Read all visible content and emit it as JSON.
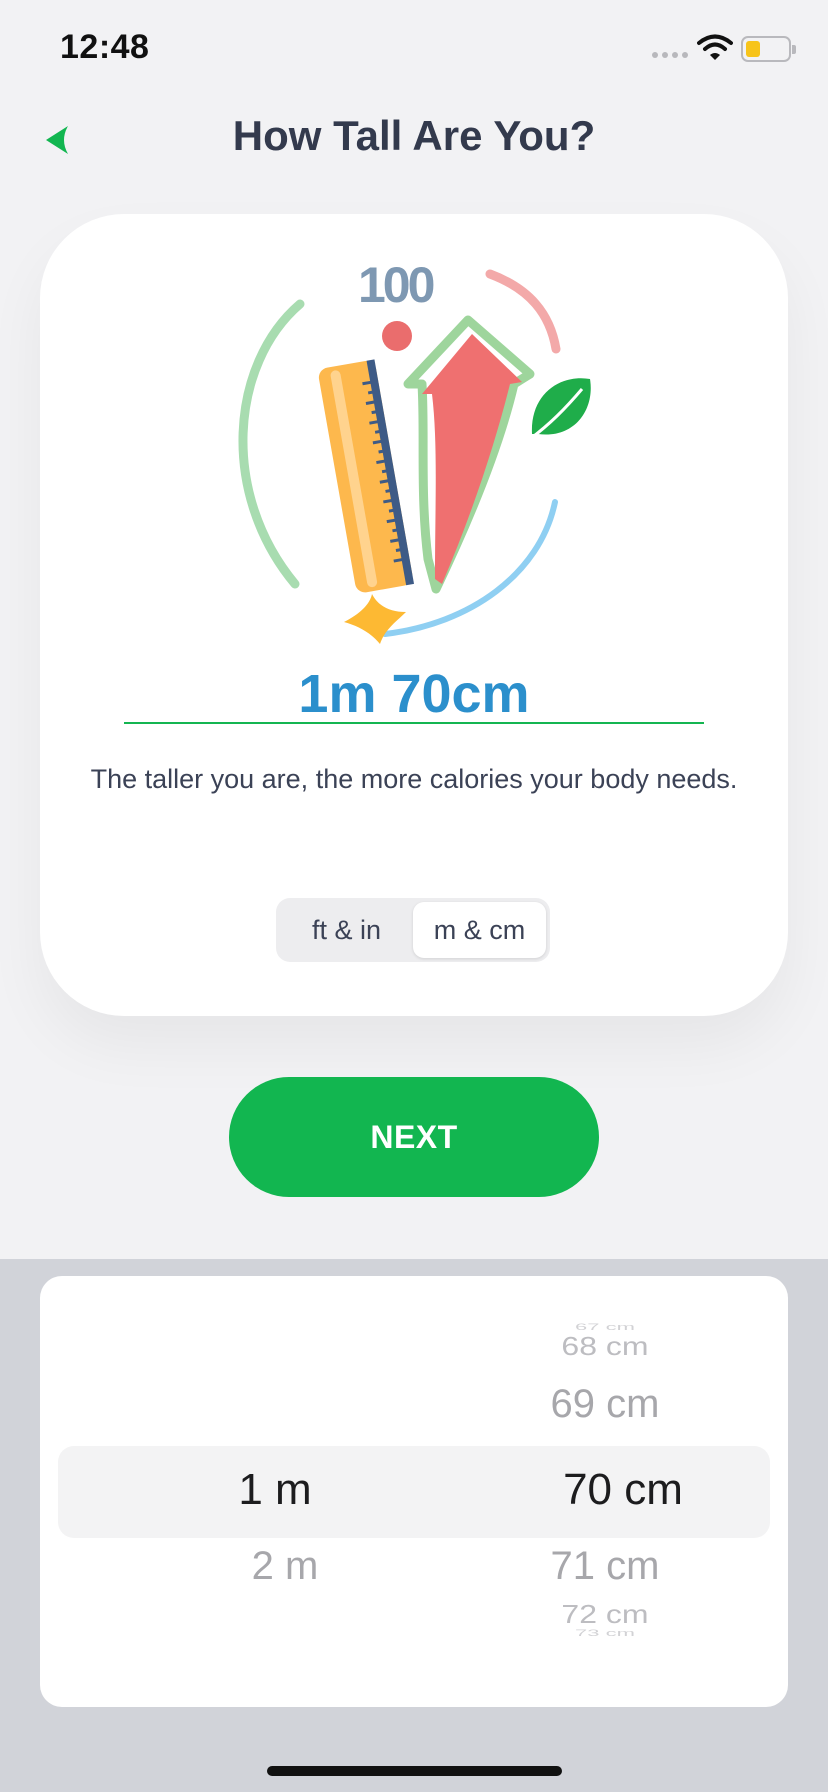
{
  "status_bar": {
    "time": "12:48"
  },
  "header": {
    "title": "How Tall Are You?"
  },
  "illustration": {
    "badge_text": "100"
  },
  "height": {
    "value": "1m 70cm",
    "description": "The taller you are, the more calories your body needs."
  },
  "units": {
    "options": [
      "ft & in",
      "m & cm"
    ],
    "selected": "m & cm"
  },
  "next_label": "NEXT",
  "picker": {
    "meters": {
      "items": [
        "1 m",
        "2 m"
      ],
      "selected": "1 m"
    },
    "centimeters": {
      "items": [
        "67 cm",
        "68 cm",
        "69 cm",
        "70 cm",
        "71 cm",
        "72 cm",
        "73 cm"
      ],
      "selected": "70 cm"
    }
  },
  "colors": {
    "accent": "#12b650",
    "value_blue": "#2b8fcc",
    "title": "#333a4d",
    "card": "#ffffff",
    "background": "#f2f2f4",
    "picker_bg": "#d1d3d9"
  }
}
